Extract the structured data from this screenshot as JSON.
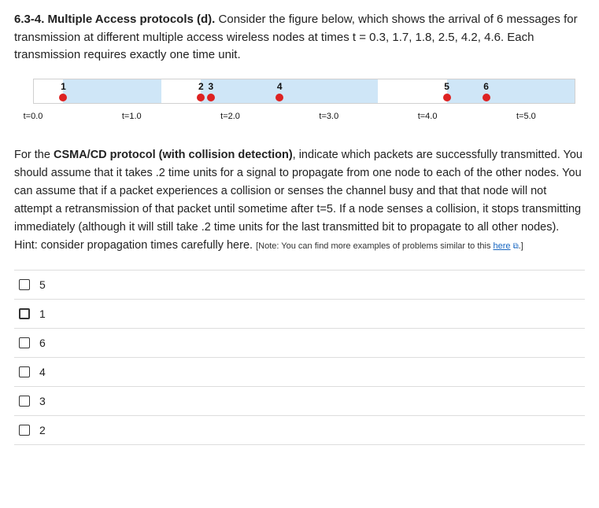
{
  "question": {
    "number": "6.3-4.",
    "heading": "Multiple Access protocols (d).",
    "body": "Consider the figure below, which shows the arrival of 6 messages for transmission at different multiple access wireless nodes at times  t = 0.3, 1.7, 1.8, 2.5, 4.2, 4.6. Each transmission requires exactly one time unit."
  },
  "chart_data": {
    "type": "bar",
    "title": "",
    "xlabel": "t",
    "ylabel": "",
    "xlim": [
      0.0,
      5.5
    ],
    "segments": [
      {
        "start": 0.3,
        "end": 1.3
      },
      {
        "start": 1.7,
        "end": 3.5
      },
      {
        "start": 4.2,
        "end": 5.5
      }
    ],
    "packets": [
      {
        "id": "1",
        "t": 0.3
      },
      {
        "id": "2",
        "t": 1.7
      },
      {
        "id": "3",
        "t": 1.8
      },
      {
        "id": "4",
        "t": 2.5
      },
      {
        "id": "5",
        "t": 4.2
      },
      {
        "id": "6",
        "t": 4.6
      }
    ],
    "ticks": [
      {
        "label": "t=0.0",
        "t": 0.0
      },
      {
        "label": "t=1.0",
        "t": 1.0
      },
      {
        "label": "t=2.0",
        "t": 2.0
      },
      {
        "label": "t=3.0",
        "t": 3.0
      },
      {
        "label": "t=4.0",
        "t": 4.0
      },
      {
        "label": "t=5.0",
        "t": 5.0
      }
    ]
  },
  "explain": {
    "lead": "For the ",
    "bold": "CSMA/CD protocol (with collision detection)",
    "rest": ", indicate which packets are successfully transmitted. You should assume that it takes .2 time units for a signal to propagate from one node to each of the other nodes. You can assume that if a packet experiences a collision or senses the channel busy and that that node will not attempt a retransmission of that packet until sometime after t=5. If a node senses a collision, it stops transmitting immediately (although it will still take .2 time units for the last transmitted bit to propagate to all other nodes). Hint: consider propagation times carefully here.",
    "note_prefix": " [Note: You can find more examples of problems similar to this ",
    "note_link": "here",
    "note_suffix": ".]"
  },
  "options": [
    {
      "label": "5"
    },
    {
      "label": "1"
    },
    {
      "label": "6"
    },
    {
      "label": "4"
    },
    {
      "label": "3"
    },
    {
      "label": "2"
    }
  ]
}
